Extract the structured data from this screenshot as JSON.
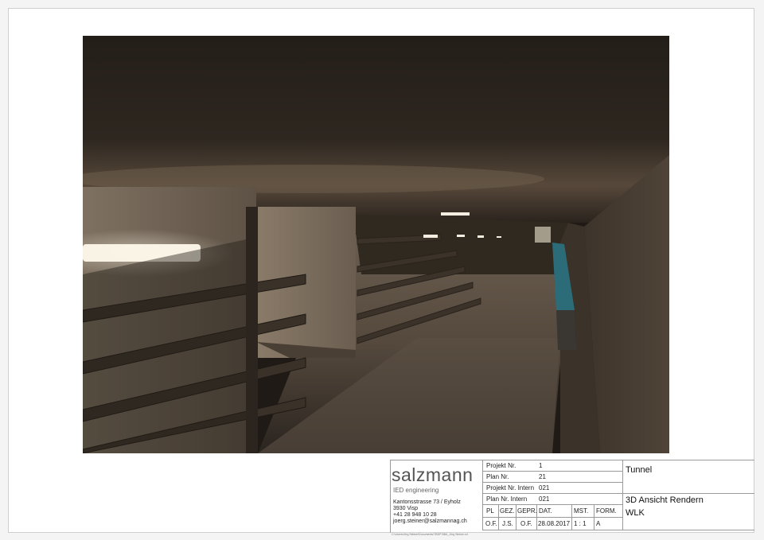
{
  "title_block": {
    "company": "salzmann",
    "division": "IED engineering",
    "address_lines": [
      "Kantonsstrasse 73 / Eyholz",
      "3930 Visp",
      "+41 28 948 10 28",
      "joerg.steiner@salzmannag.ch"
    ],
    "rows": [
      {
        "label": "Projekt Nr.",
        "value": "1"
      },
      {
        "label": "Plan Nr.",
        "value": "21"
      },
      {
        "label": "Projekt Nr. Intern",
        "value": "021"
      },
      {
        "label": "Plan Nr. Intern",
        "value": "021"
      }
    ],
    "headers": [
      "PL",
      "GEZ.",
      "GEPR.",
      "DAT.",
      "MST.",
      "FORM."
    ],
    "values": [
      "O.F.",
      "J.S.",
      "O.F.",
      "28.08.2017",
      "1 : 1",
      "A"
    ],
    "project_name": "Tunnel",
    "description_line1": "3D Ansicht Rendern",
    "description_line2": "WLK",
    "file_path": "C:\\Users\\Jörg Steiner\\Documents\\TBDP BBA_Jörg Steiner.rvt"
  },
  "colors": {
    "tunnel_dark": "#1f1a15",
    "tunnel_light": "#cbbfae",
    "water_channel": "#2c6c78"
  }
}
